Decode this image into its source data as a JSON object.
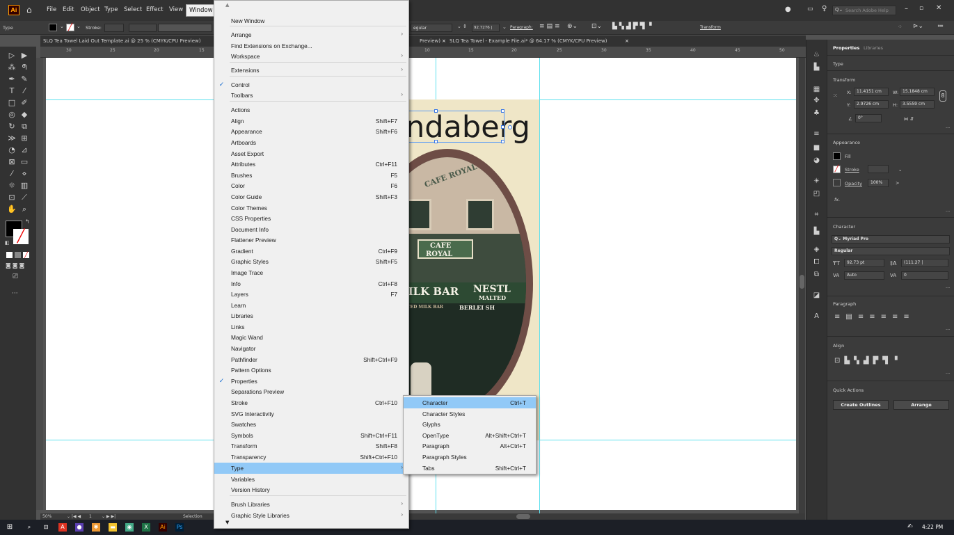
{
  "app": {
    "logo": "Ai",
    "home_icon": "home-icon"
  },
  "menubar": {
    "items": [
      "File",
      "Edit",
      "Object",
      "Type",
      "Select",
      "Effect",
      "View",
      "Window"
    ],
    "search_placeholder": "Search Adobe Help",
    "time": "4:22 PM"
  },
  "control": {
    "left_label": "Type",
    "stroke_label": "Stroke:",
    "font_style": "egular",
    "size_value": "92.7276 |",
    "paragraph_label": "Paragraph:",
    "transform_label": "Transform"
  },
  "tabs": {
    "doc1": "SLQ Tea Towel Laid Out Template.ai @ 25 % (CMYK/CPU Preview)",
    "doc1_suffix": "Preview)",
    "doc2": "SLQ Tea Towel - Example File.ai* @ 64.17 % (CMYK/CPU Preview)"
  },
  "ruler": {
    "h_ticks": [
      "30",
      "25",
      "20",
      "15",
      "10",
      "15",
      "20",
      "25",
      "30",
      "35",
      "40",
      "45",
      "50"
    ]
  },
  "artwork": {
    "headline": "ndaberg",
    "sign_line1": "CAFE",
    "sign_line2": "ROYAL",
    "sign_line3": "MILK BAR",
    "sign_line4": "NESTL",
    "sign_line5": "MALTED",
    "awning1": "MALTED MILK BAR",
    "awning2": "BERLEI SH",
    "arch_text": "CAFE ROYAL"
  },
  "status": {
    "zoom": "50%",
    "page": "1",
    "tool": "Selection"
  },
  "window_menu": {
    "rows": [
      {
        "label": "New Window",
        "shortcut": "",
        "submenu": false,
        "checked": false
      },
      {
        "label": "Arrange",
        "shortcut": "",
        "submenu": true,
        "checked": false
      },
      {
        "label": "Find Extensions on Exchange...",
        "shortcut": "",
        "submenu": false,
        "checked": false
      },
      {
        "label": "Workspace",
        "shortcut": "",
        "submenu": true,
        "checked": false
      },
      {
        "label": "Extensions",
        "shortcut": "",
        "submenu": true,
        "checked": false
      },
      {
        "label": "Control",
        "shortcut": "",
        "submenu": false,
        "checked": true
      },
      {
        "label": "Toolbars",
        "shortcut": "",
        "submenu": true,
        "checked": false
      },
      {
        "label": "Actions",
        "shortcut": "",
        "submenu": false,
        "checked": false
      },
      {
        "label": "Align",
        "shortcut": "Shift+F7",
        "submenu": false,
        "checked": false
      },
      {
        "label": "Appearance",
        "shortcut": "Shift+F6",
        "submenu": false,
        "checked": false
      },
      {
        "label": "Artboards",
        "shortcut": "",
        "submenu": false,
        "checked": false
      },
      {
        "label": "Asset Export",
        "shortcut": "",
        "submenu": false,
        "checked": false
      },
      {
        "label": "Attributes",
        "shortcut": "Ctrl+F11",
        "submenu": false,
        "checked": false
      },
      {
        "label": "Brushes",
        "shortcut": "F5",
        "submenu": false,
        "checked": false
      },
      {
        "label": "Color",
        "shortcut": "F6",
        "submenu": false,
        "checked": false
      },
      {
        "label": "Color Guide",
        "shortcut": "Shift+F3",
        "submenu": false,
        "checked": false
      },
      {
        "label": "Color Themes",
        "shortcut": "",
        "submenu": false,
        "checked": false
      },
      {
        "label": "CSS Properties",
        "shortcut": "",
        "submenu": false,
        "checked": false
      },
      {
        "label": "Document Info",
        "shortcut": "",
        "submenu": false,
        "checked": false
      },
      {
        "label": "Flattener Preview",
        "shortcut": "",
        "submenu": false,
        "checked": false
      },
      {
        "label": "Gradient",
        "shortcut": "Ctrl+F9",
        "submenu": false,
        "checked": false
      },
      {
        "label": "Graphic Styles",
        "shortcut": "Shift+F5",
        "submenu": false,
        "checked": false
      },
      {
        "label": "Image Trace",
        "shortcut": "",
        "submenu": false,
        "checked": false
      },
      {
        "label": "Info",
        "shortcut": "Ctrl+F8",
        "submenu": false,
        "checked": false
      },
      {
        "label": "Layers",
        "shortcut": "F7",
        "submenu": false,
        "checked": false
      },
      {
        "label": "Learn",
        "shortcut": "",
        "submenu": false,
        "checked": false
      },
      {
        "label": "Libraries",
        "shortcut": "",
        "submenu": false,
        "checked": false
      },
      {
        "label": "Links",
        "shortcut": "",
        "submenu": false,
        "checked": false
      },
      {
        "label": "Magic Wand",
        "shortcut": "",
        "submenu": false,
        "checked": false
      },
      {
        "label": "Navigator",
        "shortcut": "",
        "submenu": false,
        "checked": false
      },
      {
        "label": "Pathfinder",
        "shortcut": "Shift+Ctrl+F9",
        "submenu": false,
        "checked": false
      },
      {
        "label": "Pattern Options",
        "shortcut": "",
        "submenu": false,
        "checked": false
      },
      {
        "label": "Properties",
        "shortcut": "",
        "submenu": false,
        "checked": true
      },
      {
        "label": "Separations Preview",
        "shortcut": "",
        "submenu": false,
        "checked": false
      },
      {
        "label": "Stroke",
        "shortcut": "Ctrl+F10",
        "submenu": false,
        "checked": false
      },
      {
        "label": "SVG Interactivity",
        "shortcut": "",
        "submenu": false,
        "checked": false
      },
      {
        "label": "Swatches",
        "shortcut": "",
        "submenu": false,
        "checked": false
      },
      {
        "label": "Symbols",
        "shortcut": "Shift+Ctrl+F11",
        "submenu": false,
        "checked": false
      },
      {
        "label": "Transform",
        "shortcut": "Shift+F8",
        "submenu": false,
        "checked": false
      },
      {
        "label": "Transparency",
        "shortcut": "Shift+Ctrl+F10",
        "submenu": false,
        "checked": false
      },
      {
        "label": "Type",
        "shortcut": "",
        "submenu": true,
        "checked": false
      },
      {
        "label": "Variables",
        "shortcut": "",
        "submenu": false,
        "checked": false
      },
      {
        "label": "Version History",
        "shortcut": "",
        "submenu": false,
        "checked": false
      },
      {
        "label": "Brush Libraries",
        "shortcut": "",
        "submenu": true,
        "checked": false
      },
      {
        "label": "Graphic Style Libraries",
        "shortcut": "",
        "submenu": true,
        "checked": false
      }
    ]
  },
  "type_submenu": {
    "rows": [
      {
        "label": "Character",
        "shortcut": "Ctrl+T"
      },
      {
        "label": "Character Styles",
        "shortcut": ""
      },
      {
        "label": "Glyphs",
        "shortcut": ""
      },
      {
        "label": "OpenType",
        "shortcut": "Alt+Shift+Ctrl+T"
      },
      {
        "label": "Paragraph",
        "shortcut": "Alt+Ctrl+T"
      },
      {
        "label": "Paragraph Styles",
        "shortcut": ""
      },
      {
        "label": "Tabs",
        "shortcut": "Shift+Ctrl+T"
      }
    ]
  },
  "properties": {
    "tab_properties": "Properties",
    "tab_libraries": "Libraries",
    "type_label": "Type",
    "transform_title": "Transform",
    "x_label": "X:",
    "x_value": "11.4151 cm",
    "w_label": "W:",
    "w_value": "15.1848 cm",
    "y_label": "Y:",
    "y_value": "2.9726 cm",
    "h_label": "H:",
    "h_value": "3.5559 cm",
    "angle_value": "0°",
    "appearance_title": "Appearance",
    "fill_label": "Fill",
    "stroke_label": "Stroke",
    "opacity_label": "Opacity",
    "opacity_value": "100%",
    "fx_label": "fx.",
    "character_title": "Character",
    "font_name": "Myriad Pro",
    "font_style": "Regular",
    "font_size": "92.73 pt",
    "leading": "(111.27 |",
    "kerning": "Auto",
    "tracking": "0",
    "paragraph_title": "Paragraph",
    "align_title": "Align",
    "quick_actions_title": "Quick Actions",
    "create_outlines": "Create Outlines",
    "arrange": "Arrange"
  },
  "colors": {
    "menu_highlight": "#91c9f7",
    "guide": "#5ee0ee",
    "beige": "#efe6c7",
    "check": "#1b6fd1"
  }
}
